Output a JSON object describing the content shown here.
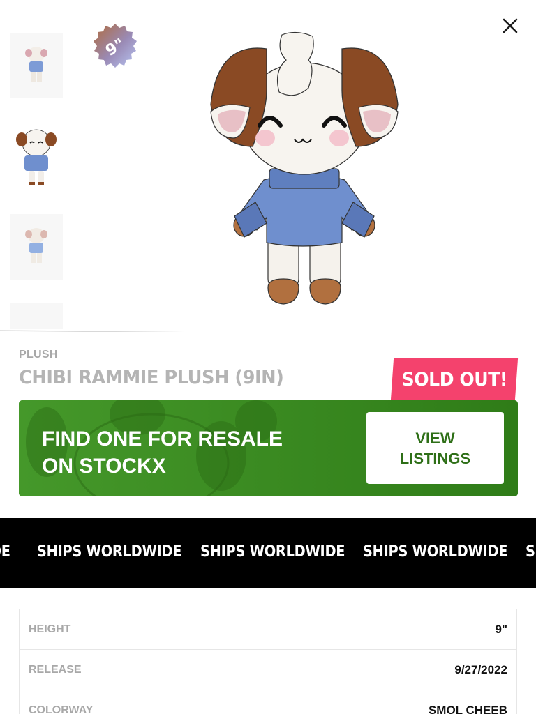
{
  "gallery": {
    "size_badge": "9\"",
    "thumbnails": [
      {
        "alt": "thumbnail-1"
      },
      {
        "alt": "thumbnail-2"
      },
      {
        "alt": "thumbnail-3"
      },
      {
        "alt": "thumbnail-4"
      }
    ],
    "close_icon": "close-icon"
  },
  "product": {
    "category": "PLUSH",
    "title": "CHIBI RAMMIE PLUSH (9IN)",
    "status_badge": "SOLD OUT!"
  },
  "resale": {
    "text": "FIND ONE FOR RESALE\nON STOCKX",
    "button_label": "VIEW\nLISTINGS"
  },
  "marquee": {
    "items": [
      "DE",
      "SHIPS WORLDWIDE",
      "SHIPS WORLDWIDE",
      "SHIPS WORLDWIDE",
      "SI"
    ]
  },
  "specs": [
    {
      "label": "HEIGHT",
      "value": "9\""
    },
    {
      "label": "RELEASE",
      "value": "9/27/2022"
    },
    {
      "label": "COLORWAY",
      "value": "SMOL CHEEB"
    }
  ],
  "colors": {
    "sold_out_badge": "#f4426d",
    "resale_banner": "#3a8a1f",
    "button_text": "#2e6f17",
    "marquee_bg": "#000000",
    "sweater": "#6f8fce",
    "horn": "#8a4a24"
  }
}
